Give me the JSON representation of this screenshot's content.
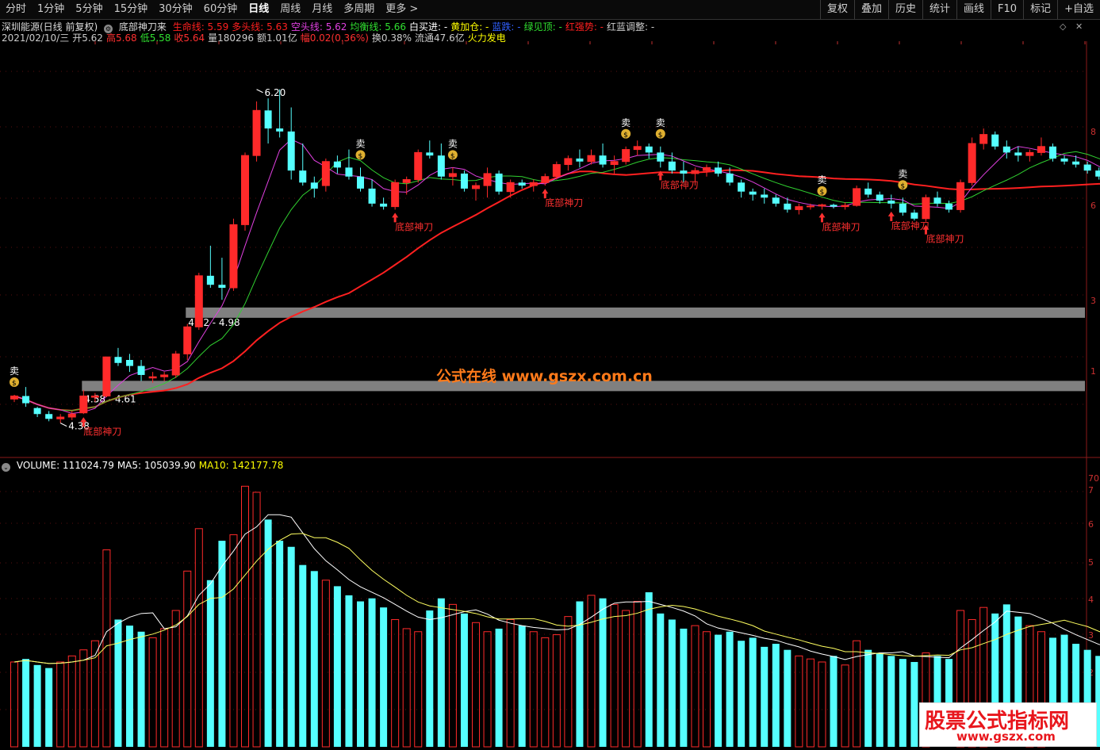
{
  "toolbar": {
    "left": [
      "分时",
      "1分钟",
      "5分钟",
      "15分钟",
      "30分钟",
      "60分钟",
      "日线",
      "周线",
      "月线",
      "多周期",
      "更多 >"
    ],
    "active": "日线",
    "right": [
      "复权",
      "叠加",
      "历史",
      "统计",
      "画线",
      "F10",
      "标记",
      "+自选"
    ]
  },
  "info": {
    "title": "深圳能源(日线 前复权)",
    "indicator": "底部神刀来",
    "lines": [
      {
        "label": "生命线: 5.59",
        "color": "#ff2020"
      },
      {
        "label": "多头线: 5.63",
        "color": "#ff2020"
      },
      {
        "label": "空头线: 5.62",
        "color": "#e040e0"
      },
      {
        "label": "均衡线: 5.66",
        "color": "#30e030"
      },
      {
        "label": "白买进: -",
        "color": "#ffffff"
      },
      {
        "label": "黄加仓: -",
        "color": "#ffff00"
      },
      {
        "label": "蓝跌: -",
        "color": "#3060ff"
      },
      {
        "label": "绿见顶: -",
        "color": "#30e030"
      },
      {
        "label": "红强势: -",
        "color": "#ff2020"
      },
      {
        "label": "红蓝调整: -",
        "color": "#cccccc"
      }
    ],
    "quote": [
      {
        "text": "2021/02/10/三",
        "color": "#cccccc"
      },
      {
        "text": "开5.62",
        "color": "#cccccc"
      },
      {
        "text": "高5.68",
        "color": "#ff3030"
      },
      {
        "text": "低5.58",
        "color": "#30e030"
      },
      {
        "text": "收5.64",
        "color": "#ff3030"
      },
      {
        "text": "量180296",
        "color": "#cccccc"
      },
      {
        "text": "额1.01亿",
        "color": "#cccccc"
      },
      {
        "text": "幅0.02(0.36%)",
        "color": "#ff3030"
      },
      {
        "text": "换0.38%",
        "color": "#cccccc"
      },
      {
        "text": "流通47.6亿",
        "color": "#cccccc"
      },
      {
        "text": "火力发电",
        "color": "#ffff00"
      }
    ]
  },
  "volume_info": [
    {
      "text": "VOLUME: 111024.79",
      "color": "#ffffff"
    },
    {
      "text": "MA5: 105039.90",
      "color": "#ffffff"
    },
    {
      "text": "MA10: 142177.78",
      "color": "#ffff00"
    }
  ],
  "chart_data": {
    "type": "candlestick",
    "colors": {
      "up": "#ff2a2a",
      "down": "#55ffff",
      "ma_life": "#ff2020",
      "ma_magenta": "#e040e0",
      "ma_green": "#30d030",
      "vol_ma5": "#ffffff",
      "vol_ma10": "#ffff60",
      "zone": "#808080"
    },
    "candles": [
      [
        4.75,
        4.82,
        4.7,
        4.8
      ],
      [
        4.8,
        4.95,
        4.62,
        4.68
      ],
      [
        4.6,
        4.62,
        4.45,
        4.5
      ],
      [
        4.5,
        4.55,
        4.38,
        4.42
      ],
      [
        4.42,
        4.5,
        4.35,
        4.45
      ],
      [
        4.45,
        4.55,
        4.4,
        4.5
      ],
      [
        4.52,
        4.9,
        4.5,
        4.8
      ],
      [
        4.78,
        4.85,
        4.7,
        4.8
      ],
      [
        4.8,
        5.45,
        4.78,
        5.45
      ],
      [
        5.45,
        5.6,
        5.3,
        5.35
      ],
      [
        5.4,
        5.5,
        5.2,
        5.3
      ],
      [
        5.3,
        5.4,
        5.05,
        5.15
      ],
      [
        5.1,
        5.2,
        5.02,
        5.12
      ],
      [
        5.12,
        5.2,
        5.05,
        5.15
      ],
      [
        5.15,
        5.55,
        5.1,
        5.5
      ],
      [
        5.5,
        6.0,
        5.4,
        5.95
      ],
      [
        5.95,
        6.85,
        5.9,
        6.8
      ],
      [
        6.8,
        7.3,
        6.6,
        6.65
      ],
      [
        6.65,
        7.1,
        6.4,
        6.6
      ],
      [
        6.6,
        7.75,
        6.55,
        7.65
      ],
      [
        7.65,
        8.85,
        7.55,
        8.8
      ],
      [
        8.8,
        9.7,
        8.7,
        9.55
      ],
      [
        9.55,
        9.75,
        9.0,
        9.25
      ],
      [
        9.25,
        9.9,
        9.1,
        9.2
      ],
      [
        9.2,
        9.6,
        8.4,
        8.55
      ],
      [
        8.55,
        9.0,
        8.3,
        8.35
      ],
      [
        8.35,
        8.45,
        8.1,
        8.25
      ],
      [
        8.3,
        8.75,
        8.2,
        8.7
      ],
      [
        8.7,
        8.8,
        8.5,
        8.6
      ],
      [
        8.6,
        8.9,
        8.4,
        8.45
      ],
      [
        8.45,
        8.6,
        8.2,
        8.25
      ],
      [
        8.25,
        8.4,
        7.95,
        8.0
      ],
      [
        8.0,
        8.1,
        7.9,
        7.95
      ],
      [
        7.95,
        8.4,
        7.9,
        8.35
      ],
      [
        8.35,
        8.45,
        8.15,
        8.4
      ],
      [
        8.4,
        8.9,
        8.35,
        8.85
      ],
      [
        8.85,
        9.05,
        8.75,
        8.8
      ],
      [
        8.8,
        9.0,
        8.4,
        8.45
      ],
      [
        8.45,
        8.6,
        8.3,
        8.5
      ],
      [
        8.5,
        8.55,
        8.2,
        8.25
      ],
      [
        8.25,
        8.35,
        8.05,
        8.3
      ],
      [
        8.3,
        8.6,
        8.1,
        8.5
      ],
      [
        8.5,
        8.55,
        8.15,
        8.2
      ],
      [
        8.2,
        8.4,
        8.1,
        8.35
      ],
      [
        8.35,
        8.4,
        8.25,
        8.3
      ],
      [
        8.3,
        8.4,
        8.2,
        8.35
      ],
      [
        8.35,
        8.5,
        8.3,
        8.45
      ],
      [
        8.45,
        8.7,
        8.4,
        8.65
      ],
      [
        8.65,
        8.8,
        8.55,
        8.75
      ],
      [
        8.75,
        8.9,
        8.6,
        8.7
      ],
      [
        8.7,
        8.9,
        8.65,
        8.8
      ],
      [
        8.8,
        9.0,
        8.6,
        8.65
      ],
      [
        8.65,
        8.8,
        8.5,
        8.7
      ],
      [
        8.7,
        8.95,
        8.65,
        8.9
      ],
      [
        8.9,
        9.05,
        8.8,
        8.95
      ],
      [
        8.95,
        9.0,
        8.75,
        8.85
      ],
      [
        8.85,
        8.95,
        8.6,
        8.7
      ],
      [
        8.7,
        8.85,
        8.5,
        8.55
      ],
      [
        8.55,
        8.7,
        8.35,
        8.5
      ],
      [
        8.5,
        8.6,
        8.3,
        8.55
      ],
      [
        8.55,
        8.65,
        8.45,
        8.6
      ],
      [
        8.6,
        8.7,
        8.45,
        8.5
      ],
      [
        8.5,
        8.6,
        8.3,
        8.35
      ],
      [
        8.35,
        8.4,
        8.1,
        8.2
      ],
      [
        8.2,
        8.25,
        8.05,
        8.15
      ],
      [
        8.15,
        8.25,
        8.0,
        8.1
      ],
      [
        8.1,
        8.15,
        7.95,
        8.0
      ],
      [
        8.0,
        8.1,
        7.85,
        7.9
      ],
      [
        7.9,
        8.0,
        7.82,
        7.95
      ],
      [
        7.95,
        8.0,
        7.9,
        7.96
      ],
      [
        7.96,
        8.0,
        7.9,
        7.98
      ],
      [
        7.98,
        8.0,
        7.92,
        7.95
      ],
      [
        7.95,
        8.02,
        7.9,
        7.97
      ],
      [
        7.97,
        8.3,
        7.95,
        8.25
      ],
      [
        8.25,
        8.35,
        8.1,
        8.15
      ],
      [
        8.15,
        8.2,
        8.0,
        8.05
      ],
      [
        8.05,
        8.15,
        7.92,
        8.0
      ],
      [
        8.0,
        8.1,
        7.8,
        7.85
      ],
      [
        7.85,
        7.9,
        7.72,
        7.75
      ],
      [
        7.75,
        8.15,
        7.7,
        8.1
      ],
      [
        8.1,
        8.2,
        7.95,
        8.0
      ],
      [
        8.0,
        8.05,
        7.85,
        7.9
      ],
      [
        7.9,
        8.4,
        7.85,
        8.35
      ],
      [
        8.35,
        9.1,
        8.3,
        9.0
      ],
      [
        9.0,
        9.25,
        8.9,
        9.15
      ],
      [
        9.15,
        9.2,
        8.9,
        8.95
      ],
      [
        8.95,
        9.05,
        8.75,
        8.85
      ],
      [
        8.85,
        8.95,
        8.7,
        8.8
      ],
      [
        8.8,
        8.9,
        8.7,
        8.85
      ],
      [
        8.85,
        9.1,
        8.8,
        8.95
      ],
      [
        8.95,
        9.0,
        8.7,
        8.75
      ],
      [
        8.75,
        8.8,
        8.65,
        8.7
      ],
      [
        8.7,
        8.8,
        8.6,
        8.65
      ],
      [
        8.65,
        8.7,
        8.5,
        8.55
      ],
      [
        8.55,
        8.6,
        8.4,
        8.45
      ],
      [
        8.45,
        8.55,
        8.3,
        8.4
      ],
      [
        8.4,
        8.5,
        8.3,
        8.38
      ],
      [
        8.38,
        8.55,
        8.35,
        8.5
      ]
    ],
    "volume": [
      2.8,
      2.9,
      2.7,
      2.6,
      2.8,
      3.0,
      3.2,
      3.5,
      6.5,
      4.2,
      4.0,
      3.8,
      3.6,
      3.9,
      4.5,
      5.8,
      7.2,
      5.5,
      6.8,
      7.0,
      8.6,
      8.4,
      7.5,
      6.8,
      6.6,
      6.0,
      5.8,
      5.5,
      5.3,
      5.0,
      4.8,
      4.9,
      4.6,
      4.2,
      3.9,
      3.8,
      4.5,
      4.9,
      4.7,
      4.4,
      4.1,
      3.8,
      3.9,
      4.2,
      4.0,
      3.8,
      3.6,
      3.7,
      4.3,
      4.8,
      5.0,
      4.9,
      4.7,
      4.5,
      4.8,
      5.1,
      4.4,
      4.2,
      3.9,
      4.0,
      3.8,
      3.7,
      3.8,
      3.5,
      3.6,
      3.3,
      3.4,
      3.2,
      3.0,
      2.9,
      2.8,
      3.0,
      2.7,
      3.5,
      3.2,
      3.1,
      3.0,
      2.9,
      2.8,
      3.1,
      3.0,
      2.9,
      4.5,
      4.2,
      4.6,
      4.4,
      4.7,
      4.3,
      4.0,
      3.8,
      3.6,
      3.7,
      3.4,
      3.2,
      3.0,
      3.1,
      3.3
    ],
    "zones": [
      {
        "price": 6.18,
        "label": "4.92 - 4.98"
      },
      {
        "price": 4.96,
        "label": "4.58 - 4.61"
      }
    ],
    "price_labels": [
      {
        "index": 21,
        "price": 9.9,
        "text": "6.20"
      },
      {
        "index": 4,
        "price": 4.35,
        "text": "4.38"
      }
    ],
    "sell_marks": [
      0,
      30,
      38,
      53,
      56,
      70,
      77
    ],
    "buy_marks": [
      {
        "index": 6,
        "label": "底部神刀"
      },
      {
        "index": 33,
        "label": "底部神刀"
      },
      {
        "index": 46,
        "label": "底部神刀"
      },
      {
        "index": 56,
        "label": "底部神刀"
      },
      {
        "index": 70,
        "label": "底部神刀"
      },
      {
        "index": 76,
        "label": "底部神刀"
      },
      {
        "index": 79,
        "label": "底部神刀"
      }
    ],
    "sell_text": "卖",
    "money_text": "$",
    "axis_right": [
      "8",
      "6",
      "3",
      "1"
    ],
    "vol_axis_right": [
      "70",
      "7",
      "6",
      "5",
      "4",
      "3",
      "2"
    ]
  },
  "watermark": {
    "center": "公式在线  www.gszx.com.cn",
    "corner_top": "股票公式指标网",
    "corner_bottom": "www.gszx.com"
  }
}
